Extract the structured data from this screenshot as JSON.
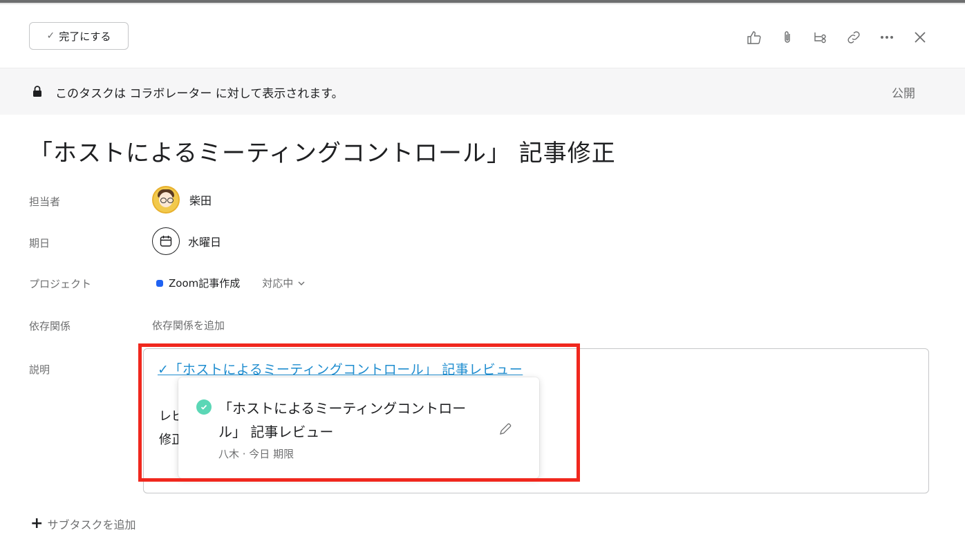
{
  "toolbar": {
    "complete_label": "完了にする",
    "icons": [
      "like-icon",
      "attachment-icon",
      "subtask-icon",
      "link-icon",
      "more-icon",
      "close-icon"
    ]
  },
  "banner": {
    "message": "このタスクは コラボレーター に対して表示されます。",
    "visibility": "公開"
  },
  "task": {
    "title": "「ホストによるミーティングコントロール」 記事修正"
  },
  "fields": {
    "assignee": {
      "label": "担当者",
      "value": "柴田"
    },
    "due_date": {
      "label": "期日",
      "value": "水曜日"
    },
    "project": {
      "label": "プロジェクト",
      "name": "Zoom記事作成",
      "status": "対応中",
      "color": "#1f62f2"
    },
    "dependencies": {
      "label": "依存関係",
      "value": "依存関係を追加"
    },
    "description": {
      "label": "説明",
      "link_text": "✓「ホストによるミーティングコントロール」 記事レビュー",
      "line1": "レビ",
      "line2": "修正"
    }
  },
  "hover_card": {
    "title": "「ホストによるミーティングコントロール」 記事レビュー",
    "meta": "八木 · 今日 期限",
    "check_color": "#5bd7b6"
  },
  "subtask": {
    "add_label": "サブタスクを追加"
  },
  "colors": {
    "highlight": "#f0281e",
    "link": "#1d8ccf"
  }
}
